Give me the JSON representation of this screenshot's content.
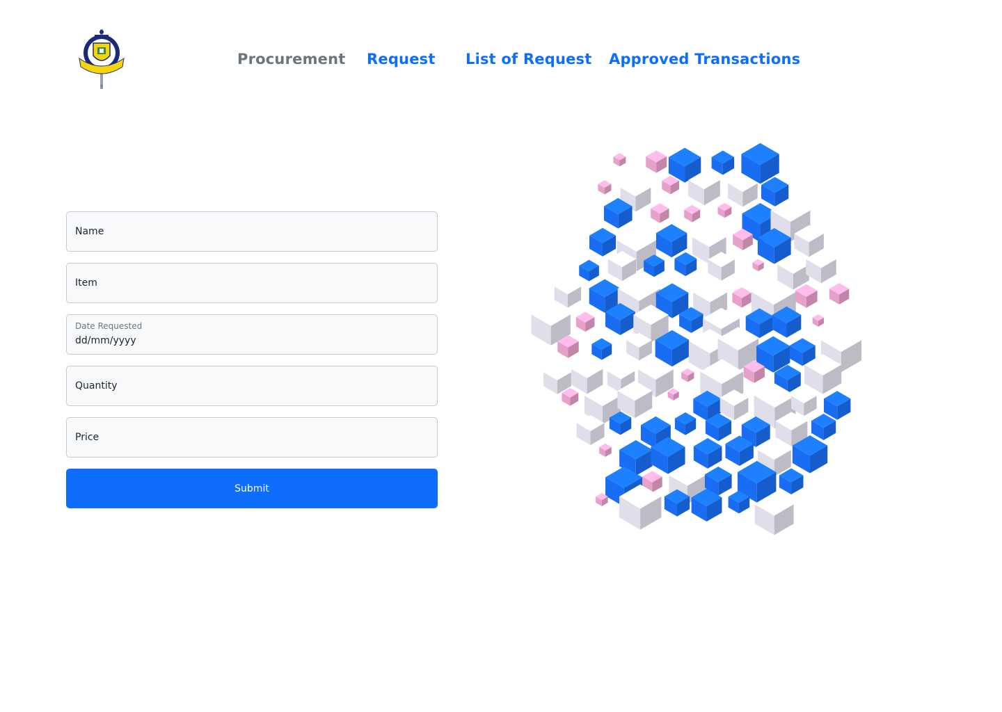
{
  "header": {
    "logo": {
      "name": "university-seal-logo",
      "colors": {
        "navy": "#1b2a78",
        "gold": "#f4d40a",
        "green": "#3a8f3f"
      }
    },
    "brand": "Procurement",
    "nav": [
      {
        "label": "Request"
      },
      {
        "label": "List of Request"
      },
      {
        "label": "Approved Transactions"
      }
    ]
  },
  "form": {
    "name_placeholder": "Name",
    "item_placeholder": "Item",
    "date_label": "Date Requested",
    "date_placeholder": "dd/mm/yyyy",
    "quantity_placeholder": "Quantity",
    "price_placeholder": "Price",
    "submit_label": "Submit"
  },
  "hero": {
    "name": "isometric-cubes-illustration",
    "colors": {
      "blue": "#1a73ff",
      "pink": "#f2a8d4",
      "white": "#eceaf7"
    }
  },
  "theme": {
    "primary": "#0d6efd",
    "brand_text": "#6c757d",
    "field_bg": "#f8f9fa",
    "field_border": "#c9cbd0"
  }
}
